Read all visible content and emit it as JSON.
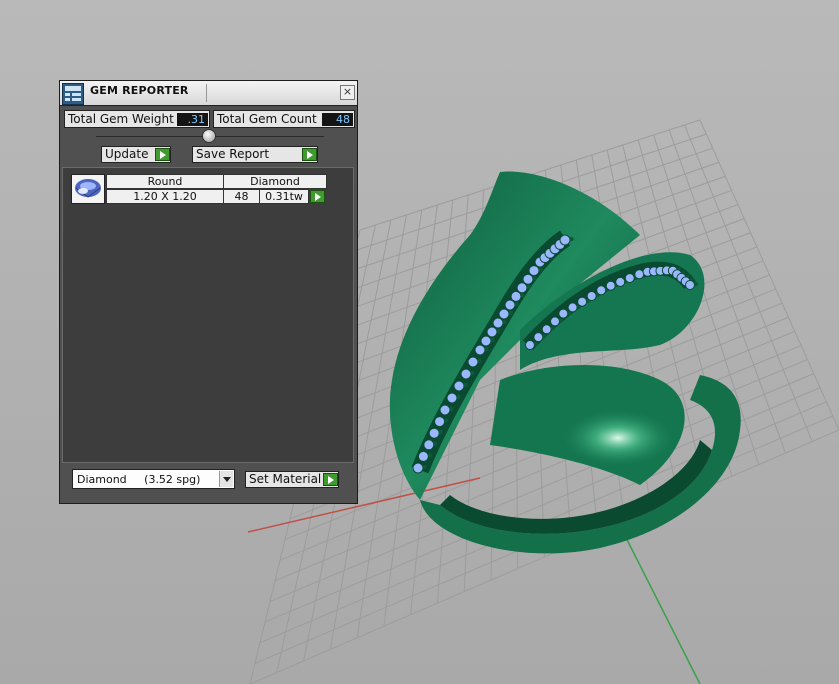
{
  "panel": {
    "title": "GEM REPORTER",
    "close_label": "×",
    "total_weight_label": "Total Gem Weight",
    "total_weight_value": ".31",
    "total_count_label": "Total Gem Count",
    "total_count_value": "48",
    "update_label": "Update",
    "save_report_label": "Save Report",
    "gems": [
      {
        "shape": "Round",
        "type": "Diamond",
        "size": "1.20 X 1.20",
        "count": "48",
        "weight": "0.31tw"
      }
    ],
    "material_select_value": "Diamond     (3.52 spg)",
    "set_material_label": "Set Material"
  },
  "viewport": {
    "ring_color": "#1c7a55",
    "gem_color": "#9bb8ff",
    "grid_color": "#9c9c9c",
    "x_axis_color": "#c05048",
    "y_axis_color": "#3aa04a"
  }
}
